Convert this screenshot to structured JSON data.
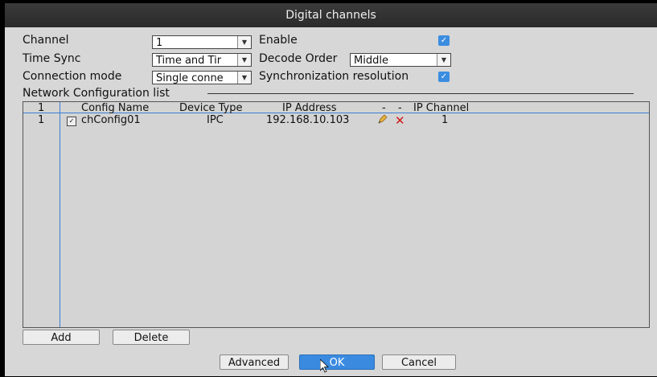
{
  "window": {
    "title": "Digital channels"
  },
  "form": {
    "channel_label": "Channel",
    "channel_value": "1",
    "enable_label": "Enable",
    "time_sync_label": "Time Sync",
    "time_sync_value": "Time and Tir",
    "decode_order_label": "Decode Order",
    "decode_order_value": "Middle",
    "connection_mode_label": "Connection mode",
    "connection_mode_value": "Single conne",
    "sync_resolution_label": "Synchronization resolution"
  },
  "list": {
    "title": "Network Configuration list",
    "headers": [
      "1",
      "Config Name",
      "Device Type",
      "IP Address",
      "-",
      "-",
      "IP Channel"
    ],
    "rows": [
      {
        "index": "1",
        "config_name": "chConfig01",
        "device_type": "IPC",
        "ip_address": "192.168.10.103",
        "ip_channel": "1"
      }
    ]
  },
  "buttons": {
    "add": "Add",
    "delete": "Delete",
    "advanced": "Advanced",
    "ok": "OK",
    "cancel": "Cancel"
  },
  "icons": {
    "edit": "pencil-icon",
    "remove": "red-x-icon",
    "accent": "#3a8be0"
  }
}
